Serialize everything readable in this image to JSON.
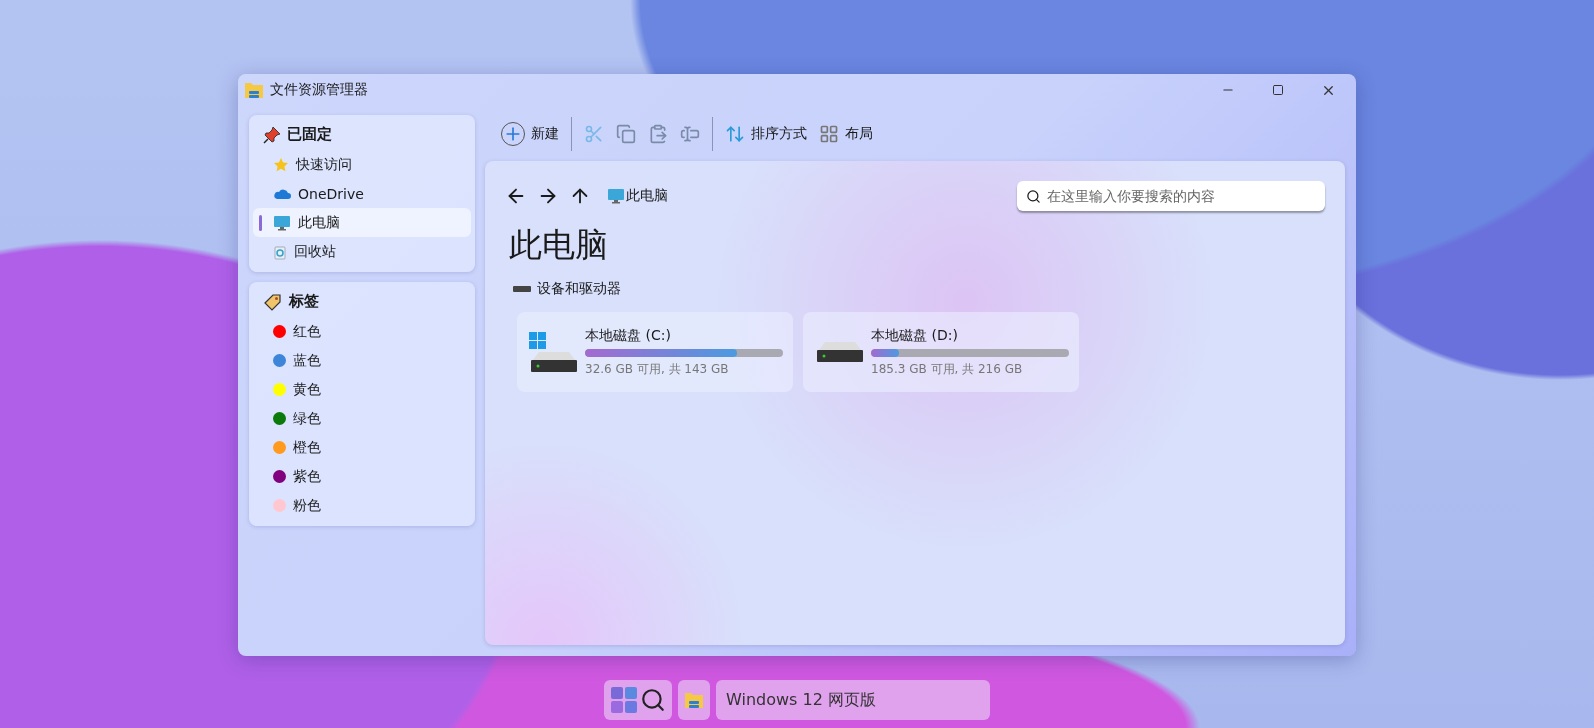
{
  "window": {
    "title": "文件资源管理器"
  },
  "sidebar": {
    "pinned": {
      "heading": "已固定",
      "items": [
        {
          "label": "快速访问",
          "kind": "star",
          "selected": false
        },
        {
          "label": "OneDrive",
          "kind": "cloud",
          "selected": false
        },
        {
          "label": "此电脑",
          "kind": "monitor",
          "selected": true
        },
        {
          "label": "回收站",
          "kind": "recycle",
          "selected": false
        }
      ]
    },
    "tags": {
      "heading": "标签",
      "items": [
        {
          "label": "红色",
          "color": "#ff0000"
        },
        {
          "label": "蓝色",
          "color": "#3d85d8"
        },
        {
          "label": "黄色",
          "color": "#ffff00"
        },
        {
          "label": "绿色",
          "color": "#0a7a0a"
        },
        {
          "label": "橙色",
          "color": "#ff9a1f"
        },
        {
          "label": "紫色",
          "color": "#800080"
        },
        {
          "label": "粉色",
          "color": "#ffc8d0"
        }
      ]
    }
  },
  "toolbar": {
    "new": "新建",
    "sort": "排序方式",
    "layout": "布局"
  },
  "address": {
    "location": "此电脑"
  },
  "search": {
    "placeholder": "在这里输入你要搜索的内容"
  },
  "page_title": "此电脑",
  "section": "设备和驱动器",
  "drives": [
    {
      "name": "本地磁盘 (C:)",
      "kind": "system",
      "level": 0.77,
      "reading": "32.6 GB 可用, 共 143 GB"
    },
    {
      "name": "本地磁盘 (D:)",
      "kind": "data",
      "level": 0.14,
      "reading": "185.3 GB 可用, 共 216 GB"
    }
  ],
  "taskbar": {
    "label": "Windows 12 网页版"
  }
}
